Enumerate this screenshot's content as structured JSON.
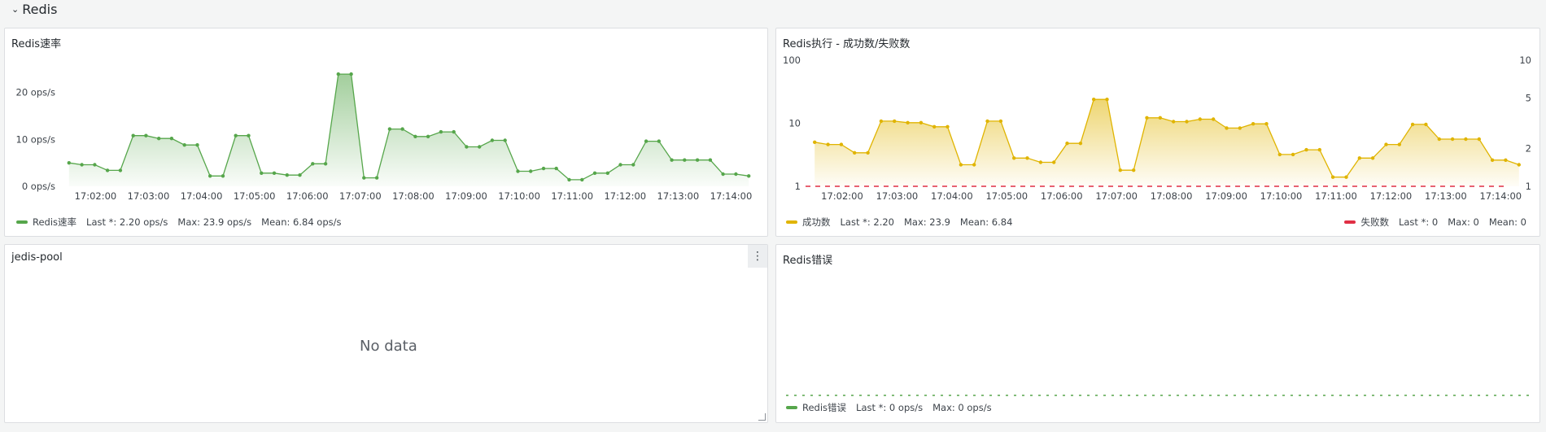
{
  "row": {
    "title": "Redis"
  },
  "panels": {
    "rate": {
      "title": "Redis速率",
      "legend": {
        "name": "Redis速率",
        "last": "Last *: 2.20 ops/s",
        "max": "Max: 23.9 ops/s",
        "mean": "Mean: 6.84 ops/s",
        "color": "#56a64b"
      }
    },
    "exec": {
      "title": "Redis执行 - 成功数/失败数",
      "legend_success": {
        "name": "成功数",
        "last": "Last *: 2.20",
        "max": "Max: 23.9",
        "mean": "Mean: 6.84",
        "color": "#e0b400"
      },
      "legend_fail": {
        "name": "失败数",
        "last": "Last *: 0",
        "max": "Max: 0",
        "mean": "Mean: 0",
        "color": "#e02f44"
      }
    },
    "jedis": {
      "title": "jedis-pool",
      "nodata": "No data",
      "menu_icon": "⋮"
    },
    "errors": {
      "title": "Redis错误",
      "legend": {
        "name": "Redis错误",
        "last": "Last *: 0 ops/s",
        "max": "Max: 0 ops/s",
        "color": "#56a64b"
      }
    }
  },
  "chart_data": [
    {
      "type": "area",
      "title": "Redis速率",
      "x_ticks": [
        "17:02:00",
        "17:03:00",
        "17:04:00",
        "17:05:00",
        "17:06:00",
        "17:07:00",
        "17:08:00",
        "17:09:00",
        "17:10:00",
        "17:11:00",
        "17:12:00",
        "17:13:00",
        "17:14:00"
      ],
      "y_ticks": [
        "0 ops/s",
        "10 ops/s",
        "20 ops/s"
      ],
      "y_tick_values": [
        0,
        10,
        20
      ],
      "ylim": [
        0,
        26
      ],
      "x_range": [
        "17:01:20",
        "17:14:30"
      ],
      "series": [
        {
          "name": "Redis速率",
          "color": "#56a64b",
          "values": [
            5,
            4.6,
            4.6,
            3.4,
            3.4,
            10.8,
            10.8,
            10.2,
            10.2,
            8.8,
            8.8,
            2.2,
            2.2,
            10.8,
            10.8,
            2.8,
            2.8,
            2.4,
            2.4,
            4.8,
            4.8,
            23.9,
            23.9,
            1.8,
            1.8,
            12.2,
            12.2,
            10.6,
            10.6,
            11.6,
            11.6,
            8.4,
            8.4,
            9.8,
            9.8,
            3.2,
            3.2,
            3.8,
            3.8,
            1.4,
            1.4,
            2.8,
            2.8,
            4.6,
            4.6,
            9.6,
            9.6,
            5.6,
            5.6,
            5.6,
            5.6,
            2.6,
            2.6,
            2.2
          ]
        }
      ]
    },
    {
      "type": "area",
      "title": "Redis执行 - 成功数/失败数",
      "x_ticks": [
        "17:02:00",
        "17:03:00",
        "17:04:00",
        "17:05:00",
        "17:06:00",
        "17:07:00",
        "17:08:00",
        "17:09:00",
        "17:10:00",
        "17:11:00",
        "17:12:00",
        "17:13:00",
        "17:14:00"
      ],
      "y_left_ticks": [
        "1",
        "10",
        "100"
      ],
      "y_right_ticks": [
        "1",
        "2",
        "5",
        "10"
      ],
      "y_scale": "log",
      "ylim_left": [
        1,
        100
      ],
      "x_range": [
        "17:01:20",
        "17:14:30"
      ],
      "series": [
        {
          "name": "成功数",
          "color": "#e0b400",
          "values": [
            5,
            4.6,
            4.6,
            3.4,
            3.4,
            10.8,
            10.8,
            10.2,
            10.2,
            8.8,
            8.8,
            2.2,
            2.2,
            10.8,
            10.8,
            2.8,
            2.8,
            2.4,
            2.4,
            4.8,
            4.8,
            23.9,
            23.9,
            1.8,
            1.8,
            12.2,
            12.2,
            10.6,
            10.6,
            11.6,
            11.6,
            8.4,
            8.4,
            9.8,
            9.8,
            3.2,
            3.2,
            3.8,
            3.8,
            1.4,
            1.4,
            2.8,
            2.8,
            4.6,
            4.6,
            9.6,
            9.6,
            5.6,
            5.6,
            5.6,
            5.6,
            2.6,
            2.6,
            2.2
          ]
        },
        {
          "name": "失败数",
          "color": "#e02f44",
          "axis": "right",
          "values": [
            0,
            0
          ]
        }
      ]
    },
    {
      "type": "line",
      "title": "Redis错误",
      "series": [
        {
          "name": "Redis错误",
          "color": "#56a64b",
          "values": [
            0,
            0
          ]
        }
      ]
    }
  ]
}
